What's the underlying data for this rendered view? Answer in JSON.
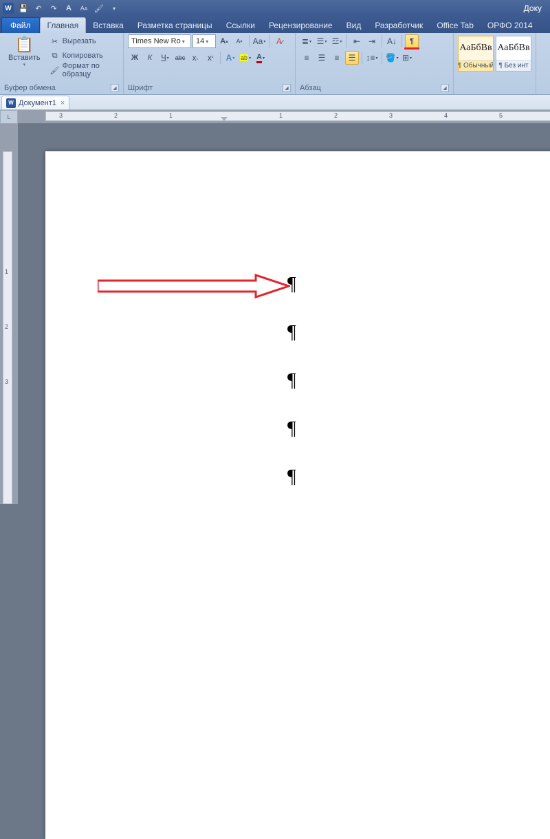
{
  "titlebar": {
    "app_icon_text": "W",
    "title_text": "Доку"
  },
  "qat": [
    "save",
    "undo",
    "redo",
    "font-size-a",
    "small-a",
    "brush",
    "customize"
  ],
  "tabs": {
    "file": "Файл",
    "items": [
      {
        "label": "Главная",
        "active": true
      },
      {
        "label": "Вставка"
      },
      {
        "label": "Разметка страницы"
      },
      {
        "label": "Ссылки"
      },
      {
        "label": "Рецензирование"
      },
      {
        "label": "Вид"
      },
      {
        "label": "Разработчик"
      },
      {
        "label": "Office Tab"
      },
      {
        "label": "ОРФО 2014"
      }
    ]
  },
  "ribbon": {
    "clipboard": {
      "paste": "Вставить",
      "cut": "Вырезать",
      "copy": "Копировать",
      "format_painter": "Формат по образцу",
      "title": "Буфер обмена"
    },
    "font": {
      "name": "Times New Ro",
      "size": "14",
      "title": "Шрифт",
      "bold": "Ж",
      "italic": "К",
      "underline": "Ч",
      "strike": "abc",
      "sub": "x",
      "sup": "x",
      "grow": "A",
      "shrink": "A",
      "changecase": "Aa",
      "clear": "A",
      "highlight": "ab",
      "fontcolor": "A"
    },
    "paragraph": {
      "title": "Абзац",
      "pilcrow": "¶"
    },
    "styles": {
      "preview_text": "АаБбВв",
      "items": [
        {
          "name": "¶ Обычный",
          "selected": true
        },
        {
          "name": "¶ Без инт"
        }
      ]
    }
  },
  "doctab": {
    "name": "Документ1",
    "close": "×"
  },
  "ruler": {
    "h_numbers": [
      "3",
      "2",
      "1",
      "1",
      "2",
      "3",
      "4",
      "5"
    ],
    "v_numbers": [
      "1",
      "2",
      "3"
    ]
  },
  "page_content": {
    "pilcrow": "¶",
    "paragraph_count": 5
  }
}
